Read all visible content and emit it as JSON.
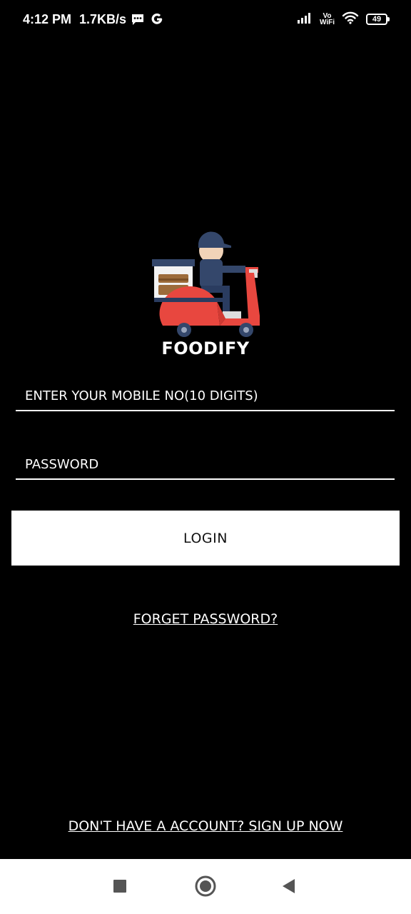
{
  "status_bar": {
    "time": "4:12 PM",
    "net_speed": "1.7KB/s",
    "vo_wifi_top": "Vo",
    "vo_wifi_bottom": "WiFi",
    "battery": "49"
  },
  "app": {
    "name": "FOODIFY"
  },
  "form": {
    "mobile_placeholder": "ENTER YOUR MOBILE NO(10 DIGITS)",
    "password_placeholder": "PASSWORD",
    "login_label": "LOGIN",
    "forget_label": "FORGET PASSWORD?",
    "signup_label": "DON'T HAVE A ACCOUNT? SIGN UP NOW"
  },
  "colors": {
    "background": "#000000",
    "text": "#ffffff",
    "scooter_red": "#e8473f",
    "rider_blue": "#34476b"
  },
  "icons": {
    "message": "message-icon",
    "google": "google-icon",
    "signal": "signal-icon",
    "wifi": "wifi-icon",
    "battery": "battery-icon",
    "logo": "delivery-scooter-icon",
    "recents": "recents-icon",
    "home": "home-icon",
    "back": "back-icon"
  }
}
